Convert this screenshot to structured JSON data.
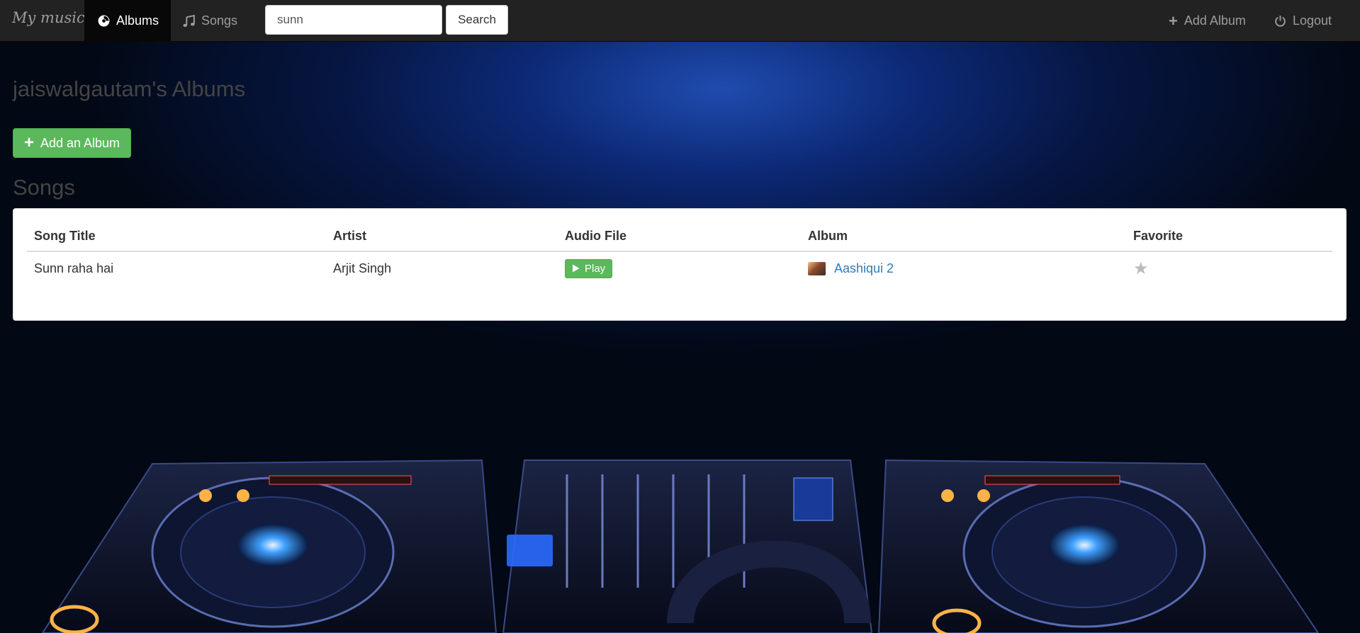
{
  "navbar": {
    "brand": "My music",
    "albums_label": "Albums",
    "songs_label": "Songs",
    "search_value": "sunn",
    "search_button": "Search",
    "add_album_label": "Add Album",
    "logout_label": "Logout"
  },
  "main": {
    "heading": "jaiswalgautam's Albums",
    "add_album_button": "Add an Album",
    "songs_heading": "Songs"
  },
  "table": {
    "headers": [
      "Song Title",
      "Artist",
      "Audio File",
      "Album",
      "Favorite"
    ],
    "rows": [
      {
        "song_title": "Sunn raha hai",
        "artist": "Arjit Singh",
        "audio_button": "Play",
        "album": "Aashiqui 2",
        "favorite_icon": "star-icon"
      }
    ]
  },
  "colors": {
    "navbar": "#222222",
    "success": "#5cb85c",
    "link": "#337ab7"
  }
}
